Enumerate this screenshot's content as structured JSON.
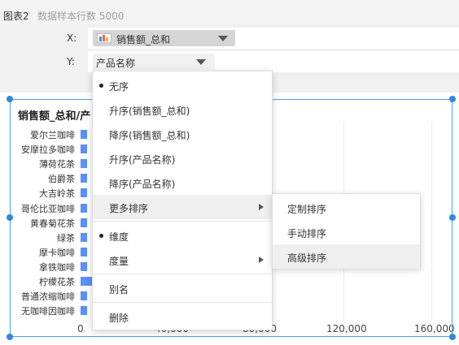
{
  "header": {
    "chart_name": "图表2",
    "sample_count": "数据样本行数 5000"
  },
  "x_axis": {
    "label": "X:",
    "field": "销售额_总和"
  },
  "y_axis": {
    "label": "Y:",
    "field": "产品名称"
  },
  "chart_data": {
    "type": "bar",
    "title": "销售额_总和/产",
    "categories": [
      "爱尔兰咖啡",
      "安摩拉多咖啡",
      "薄荷花茶",
      "伯爵茶",
      "大吉岭茶",
      "哥伦比亚咖啡",
      "黄春菊花茶",
      "绿茶",
      "摩卡咖啡",
      "拿铁咖啡",
      "柠檬花茶",
      "普通浓缩咖啡",
      "无咖啡因咖啡"
    ],
    "values": [
      2800,
      2800,
      2800,
      2800,
      2800,
      2800,
      2800,
      2800,
      2800,
      2800,
      83500,
      2800,
      2800
    ],
    "xticks": [
      "0",
      "40,000",
      "80,000",
      "120,000",
      "160,000"
    ],
    "xlim": [
      0,
      160000
    ],
    "bar_color": "#5b8ff9",
    "grid": true
  },
  "menu": {
    "items": [
      "无序",
      "升序(销售额_总和)",
      "降序(销售额_总和)",
      "升序(产品名称)",
      "降序(产品名称)",
      "更多排序",
      "维度",
      "度量",
      "别名",
      "删除"
    ]
  },
  "submenu": {
    "items": [
      "定制排序",
      "手动排序",
      "高级排序"
    ]
  },
  "colors": {
    "accent": "#2f86e4",
    "selection_frame": "#4c9ee8"
  }
}
